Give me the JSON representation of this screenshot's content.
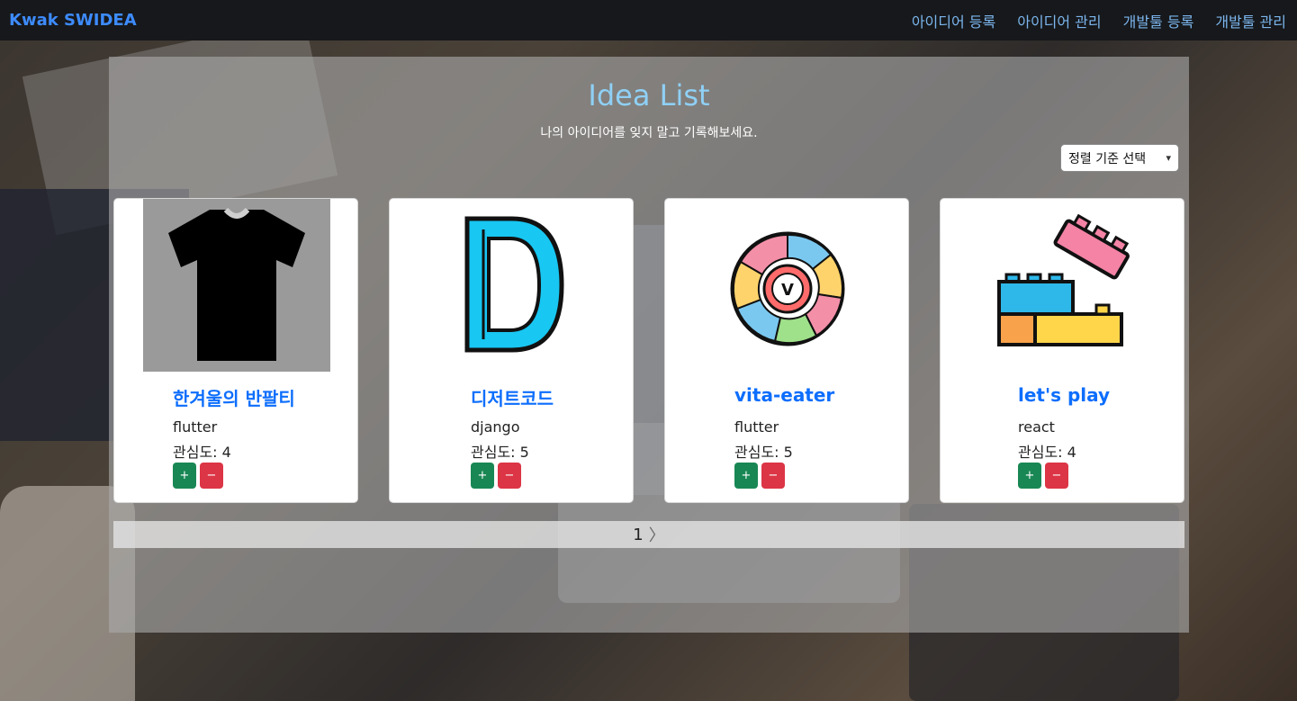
{
  "nav": {
    "brand": "Kwak SWIDEA",
    "links": [
      {
        "label": "아이디어 등록"
      },
      {
        "label": "아이디어 관리"
      },
      {
        "label": "개발툴 등록"
      },
      {
        "label": "개발툴 관리"
      }
    ]
  },
  "main": {
    "title": "Idea List",
    "subtitle": "나의 아이디어를 잊지 말고 기록해보세요.",
    "sort_label": "정렬 기준 선택",
    "cards": [
      {
        "title": "한겨울의 반팔티",
        "tech": "flutter",
        "interest": "관심도: 4",
        "icon": "tshirt-icon"
      },
      {
        "title": "디저트코드",
        "tech": "django",
        "interest": "관심도: 5",
        "icon": "letter-d-icon"
      },
      {
        "title": "vita-eater",
        "tech": "flutter",
        "interest": "관심도: 5",
        "icon": "vitamin-wheel-icon"
      },
      {
        "title": "let's play",
        "tech": "react",
        "interest": "관심도: 4",
        "icon": "lego-blocks-icon"
      }
    ],
    "plus_label": "+",
    "minus_label": "−",
    "pagination": {
      "current": "1",
      "next": "〉"
    }
  },
  "colors": {
    "brand": "#3d8bfd",
    "title": "#8fd0f5",
    "card_title": "#0d6efd",
    "plus": "#198754",
    "minus": "#dc3545"
  }
}
